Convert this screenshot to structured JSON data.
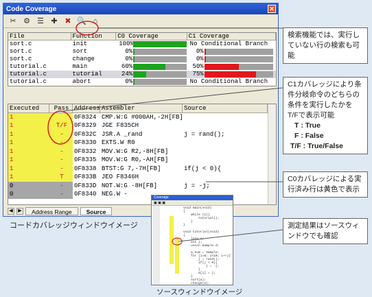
{
  "window": {
    "title": "Code Coverage",
    "close_glyph": "✕"
  },
  "toolbar": [
    {
      "name": "toolbar-icon-1",
      "glyph": "✂"
    },
    {
      "name": "toolbar-icon-2",
      "glyph": "⚙"
    },
    {
      "name": "toolbar-icon-3",
      "glyph": "☰"
    },
    {
      "name": "toolbar-icon-4",
      "glyph": "✚"
    },
    {
      "name": "toolbar-icon-5",
      "glyph": "✖"
    },
    {
      "name": "toolbar-icon-find",
      "glyph": "🔍"
    },
    {
      "name": "toolbar-icon-find-unexecuted",
      "glyph": "⌂"
    }
  ],
  "function_table": {
    "headers": [
      "File",
      "Function",
      "C0 Coverage",
      "C1 Coverage"
    ],
    "rows": [
      {
        "file": "sort.c",
        "func": "init",
        "c0": "100%",
        "c0_value": 1.0,
        "c1": "No Conditional Branch"
      },
      {
        "file": "sort.c",
        "func": "sort",
        "c0": "0%",
        "c0_value": 0.0,
        "c1": "0%",
        "c1_value": 0.0
      },
      {
        "file": "sort.c",
        "func": "change",
        "c0": "0%",
        "c0_value": 0.0,
        "c1": "0%",
        "c1_value": 0.0
      },
      {
        "file": "tutorial.c",
        "func": "main",
        "c0": "60%",
        "c0_value": 0.6,
        "c1": "50%",
        "c1_value": 0.5
      },
      {
        "file": "tutorial.c",
        "func": "tutorial",
        "c0": "24%",
        "c0_value": 0.24,
        "c1": "75%",
        "c1_value": 0.75
      },
      {
        "file": "tutorial.c",
        "func": "abort",
        "c0": "0%",
        "c0_value": 0.0,
        "c1": "No Conditional Branch"
      }
    ]
  },
  "source_table": {
    "headers": [
      "Executed",
      "Pass",
      "Address",
      "Assembler",
      "Source"
    ],
    "rows": [
      {
        "exe": "1",
        "pass": "",
        "addr": "0F8324",
        "asm": "CMP.W:G",
        "arg": "#000AH,-2H[FB]",
        "src": "",
        "state": "yellow"
      },
      {
        "exe": "1",
        "pass": "T/F",
        "addr": "0F8329",
        "asm": "JGE",
        "arg": "F835CH",
        "src": "",
        "state": "yellow"
      },
      {
        "exe": "1",
        "pass": "-",
        "addr": "0F832C",
        "asm": "JSR.A",
        "arg": "_rand",
        "src": "j = rand();",
        "state": "yellow"
      },
      {
        "exe": "1",
        "pass": "-",
        "addr": "0F8330",
        "asm": "EXTS.W",
        "arg": "R0",
        "src": "",
        "state": "yellow"
      },
      {
        "exe": "1",
        "pass": "-",
        "addr": "0F8332",
        "asm": "MOV.W:G",
        "arg": "R2,-8H[FB]",
        "src": "",
        "state": "yellow"
      },
      {
        "exe": "1",
        "pass": "-",
        "addr": "0F8335",
        "asm": "MOV.W:G",
        "arg": "R0,-AH[FB]",
        "src": "",
        "state": "yellow"
      },
      {
        "exe": "1",
        "pass": "-",
        "addr": "0F8338",
        "asm": "BTST:G",
        "arg": "7,-7H[FB]",
        "src": "if(j < 0){",
        "state": "yellow"
      },
      {
        "exe": "1",
        "pass": "T",
        "addr": "0F833B",
        "asm": "JEO",
        "arg": "F8346H",
        "src": "",
        "state": "yellow"
      },
      {
        "exe": "0",
        "pass": "-",
        "addr": "0F833D",
        "asm": "NOT.W:G",
        "arg": "-8H[FB]",
        "src": "j = -j;",
        "state": "gray"
      },
      {
        "exe": "0",
        "pass": "-",
        "addr": "0F8340",
        "asm": "NEG.W",
        "arg": "-",
        "src": "",
        "state": "gray"
      }
    ]
  },
  "tabs": [
    "Address Range",
    "Source"
  ],
  "colors": {
    "c0_fill": "#1ea31e",
    "c1_fill": "#e0171d",
    "bar_bg": "#a0a0a0",
    "yellow": "#f3f04a",
    "gray": "#a6a6a6",
    "red_text": "#d01010"
  },
  "annotations": [
    "検索機能では、実行していない行の検索も可能",
    "C1カバレッジにより条件分岐命令のどちらの条件を実行したかをT/Fで表示可能",
    "T : True",
    "F : False",
    "T/F : True/False",
    "C0カバレッジによる実行済み行は黄色で表示",
    "測定結果はソースウィンドウでも確認"
  ],
  "captions": [
    "コードカバレッジウィンドウイメージ",
    "ソースウィンドウイメージ"
  ],
  "mini_source": {
    "title": "Coverage",
    "lines": [
      "void main(void)",
      "{",
      "    while (1){",
      "        tutorial();",
      "    }",
      "}",
      "",
      "void tutorial(void)",
      "{",
      "    long a;",
      "    int j;",
      "    union Sample d;",
      "",
      "    a_sum = Sample;",
      "    for (i=0; i<10; i++){",
      "        j = rand();",
      "        if(j < 0){",
      "            j = -j;",
      "        }",
      "        a[i] = j;",
      "    }",
      "    sort(a);",
      "    change(a);",
      "    p_sum = tmp;"
    ]
  }
}
